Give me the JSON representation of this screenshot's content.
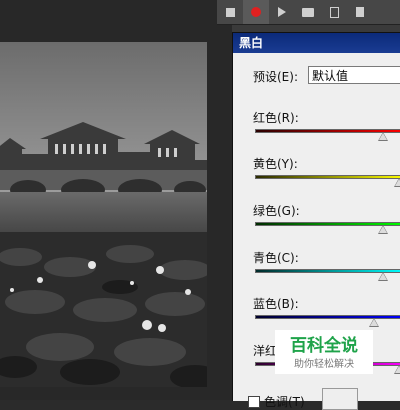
{
  "dialog": {
    "title": "黑白",
    "preset_label": "预设(E):",
    "preset_value": "默认值",
    "sliders": [
      {
        "label": "红色(R):",
        "color_from": "#2a0000",
        "color_to": "#ff0000",
        "value_fraction": 0.86
      },
      {
        "label": "黄色(Y):",
        "color_from": "#2a2a00",
        "color_to": "#ffff00",
        "value_fraction": 1.0
      },
      {
        "label": "绿色(G):",
        "color_from": "#002a00",
        "color_to": "#00ff00",
        "value_fraction": 0.86
      },
      {
        "label": "青色(C):",
        "color_from": "#002a2a",
        "color_to": "#00ffff",
        "value_fraction": 0.86
      },
      {
        "label": "蓝色(B):",
        "color_from": "#00002a",
        "color_to": "#0000ff",
        "value_fraction": 0.8
      },
      {
        "label": "洋红",
        "color_from": "#2a002a",
        "color_to": "#ff00ff",
        "value_fraction": 1.0
      }
    ],
    "tint_label": "色调(T)"
  },
  "toolbar": {
    "icons": [
      "stop-icon",
      "record-icon",
      "play-icon",
      "folder-icon",
      "new-action-icon",
      "delete-icon"
    ],
    "record_color": "#e02020"
  },
  "watermark": {
    "title": "百科全说",
    "subtitle": "助你轻松解决"
  }
}
